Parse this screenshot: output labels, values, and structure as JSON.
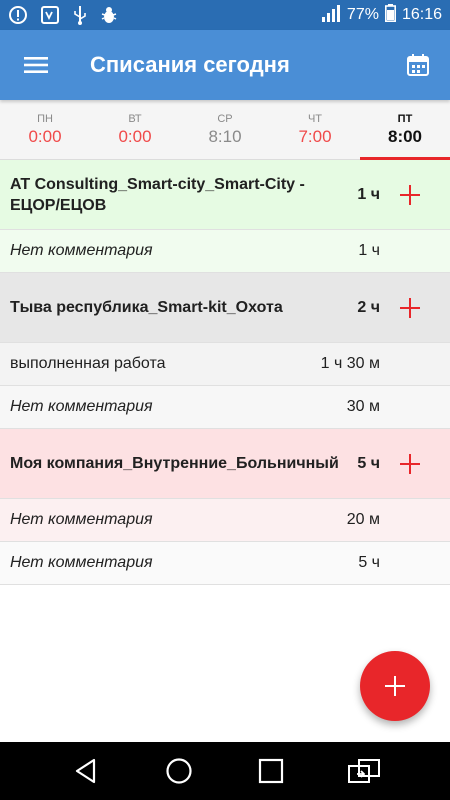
{
  "status_bar": {
    "battery": "77%",
    "time": "16:16",
    "icons": [
      "alert-icon",
      "screen-icon",
      "usb-icon",
      "bug-icon",
      "signal-icon",
      "battery-icon"
    ]
  },
  "app_bar": {
    "title": "Списания сегодня",
    "icons": [
      "menu-icon",
      "calendar-icon"
    ]
  },
  "days": [
    {
      "name": "ПН",
      "time": "0:00",
      "state": "red"
    },
    {
      "name": "ВТ",
      "time": "0:00",
      "state": "red"
    },
    {
      "name": "СР",
      "time": "8:10",
      "state": "normal"
    },
    {
      "name": "ЧТ",
      "time": "7:00",
      "state": "red"
    },
    {
      "name": "ПТ",
      "time": "8:00",
      "state": "active"
    }
  ],
  "groups": [
    {
      "project": "AT Consulting_Smart-city_Smart-City - ЕЦОР/ЕЦОВ",
      "hours": "1 ч",
      "color": "#e6fbe3",
      "entries": [
        {
          "comment": "Нет комментария",
          "hours": "1 ч"
        }
      ]
    },
    {
      "project": "Тыва республика_Smart-kit_Охота",
      "hours": "2 ч",
      "color": "#e7e7e7",
      "entries": [
        {
          "comment": "выполненная работа",
          "hours": "1 ч 30 м"
        },
        {
          "comment": "Нет комментария",
          "hours": "30 м"
        }
      ]
    },
    {
      "project": "Моя компания_Внутренние_Больничный",
      "hours": "5 ч",
      "color": "#fde1e3",
      "entries": [
        {
          "comment": "Нет комментария",
          "hours": "20 м"
        },
        {
          "comment": "Нет комментария",
          "hours": "5 ч"
        }
      ]
    }
  ],
  "colors": {
    "status_bar": "#2a6db3",
    "app_bar": "#4a8ed6",
    "accent": "#e8262a"
  },
  "nav_bar": {
    "icons": [
      "back-icon",
      "home-icon",
      "recents-icon",
      "screen-switch-icon"
    ]
  }
}
